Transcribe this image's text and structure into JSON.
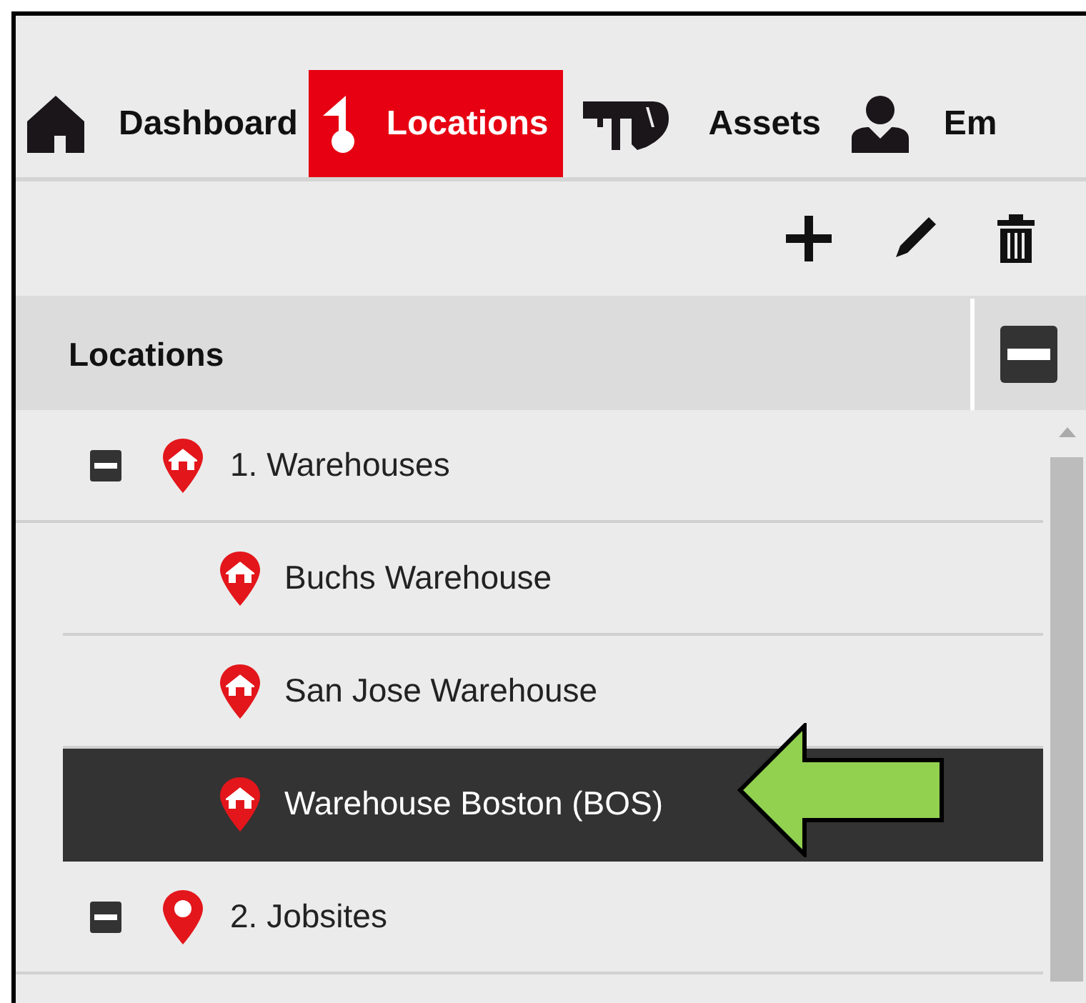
{
  "nav_tabs": [
    {
      "kind": "house",
      "label": "Dashboard",
      "selected": false
    },
    {
      "kind": "pin",
      "label": "Locations",
      "selected": true
    },
    {
      "kind": "drill",
      "label": "Assets",
      "selected": false
    },
    {
      "kind": "person",
      "label": "Em",
      "selected": false
    }
  ],
  "toolbar": [
    {
      "kind": "add"
    },
    {
      "kind": "edit"
    },
    {
      "kind": "delete"
    }
  ],
  "tree": {
    "header": "Locations",
    "items": [
      {
        "kind": "warehouse",
        "label": "1. Warehouses",
        "expanded": true,
        "selected": false,
        "children": [
          {
            "kind": "warehouse",
            "label": "Buchs Warehouse",
            "selected": false
          },
          {
            "kind": "warehouse",
            "label": "San Jose Warehouse",
            "selected": false
          },
          {
            "kind": "warehouse",
            "label": "Warehouse Boston (BOS)",
            "selected": true
          }
        ]
      },
      {
        "kind": "jobsite",
        "label": "2. Jobsites",
        "expanded": true,
        "selected": false
      }
    ]
  },
  "annotation": {
    "kind": "arrow"
  }
}
